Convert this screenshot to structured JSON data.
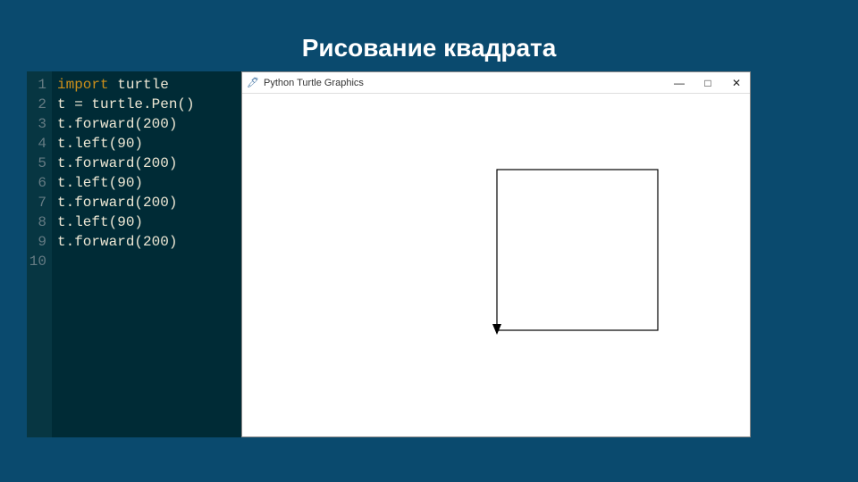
{
  "slide": {
    "title": "Рисование квадрата"
  },
  "editor": {
    "gutter": [
      "1",
      "2",
      "3",
      "4",
      "5",
      "6",
      "7",
      "8",
      "9",
      "10"
    ],
    "lines": [
      [
        {
          "cls": "kw",
          "t": "import"
        },
        {
          "cls": "plain",
          "t": " turtle"
        }
      ],
      [
        {
          "cls": "plain",
          "t": "t = turtle.Pen()"
        }
      ],
      [
        {
          "cls": "plain",
          "t": "t.forward(200)"
        }
      ],
      [
        {
          "cls": "plain",
          "t": "t.left(90)"
        }
      ],
      [
        {
          "cls": "plain",
          "t": "t.forward(200)"
        }
      ],
      [
        {
          "cls": "plain",
          "t": "t.left(90)"
        }
      ],
      [
        {
          "cls": "plain",
          "t": "t.forward(200)"
        }
      ],
      [
        {
          "cls": "plain",
          "t": "t.left(90)"
        }
      ],
      [
        {
          "cls": "plain",
          "t": "t.forward(200)"
        }
      ],
      [
        {
          "cls": "plain",
          "t": ""
        }
      ]
    ]
  },
  "turtle_window": {
    "title": "Python Turtle Graphics",
    "controls": {
      "minimize": "—",
      "maximize": "□",
      "close": "✕"
    },
    "icon_glyph": "🖊"
  }
}
